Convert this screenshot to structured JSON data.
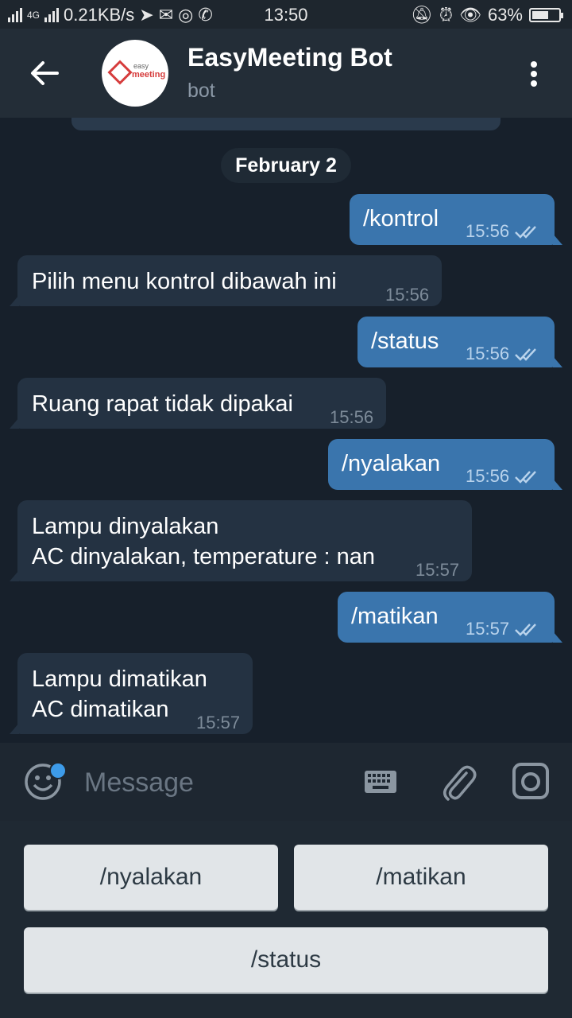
{
  "status_bar": {
    "network": "4G",
    "speed": "0.21KB/s",
    "time": "13:50",
    "battery": "63%",
    "battery_level": 0.63
  },
  "header": {
    "title": "EasyMeeting Bot",
    "subtitle": "bot",
    "avatar_text_1": "easy",
    "avatar_text_2": "meeting"
  },
  "date_separator": "February 2",
  "messages": [
    {
      "dir": "out",
      "text": "/kontrol",
      "time": "15:56"
    },
    {
      "dir": "in",
      "text": "Pilih menu kontrol dibawah ini",
      "time": "15:56"
    },
    {
      "dir": "out",
      "text": "/status",
      "time": "15:56"
    },
    {
      "dir": "in",
      "text": "Ruang rapat tidak dipakai",
      "time": "15:56"
    },
    {
      "dir": "out",
      "text": "/nyalakan",
      "time": "15:56"
    },
    {
      "dir": "in",
      "text": "Lampu dinyalakan\nAC dinyalakan, temperature : nan",
      "time": "15:57"
    },
    {
      "dir": "out",
      "text": "/matikan",
      "time": "15:57"
    },
    {
      "dir": "in",
      "text": "Lampu dimatikan\nAC dimatikan",
      "time": "15:57"
    }
  ],
  "composer": {
    "placeholder": "Message"
  },
  "bot_keyboard": {
    "buttons": [
      "/nyalakan",
      "/matikan",
      "/status"
    ]
  },
  "colors": {
    "outgoing": "#3a75ad",
    "incoming": "#243242",
    "background": "#17202b",
    "header": "#232d37"
  }
}
